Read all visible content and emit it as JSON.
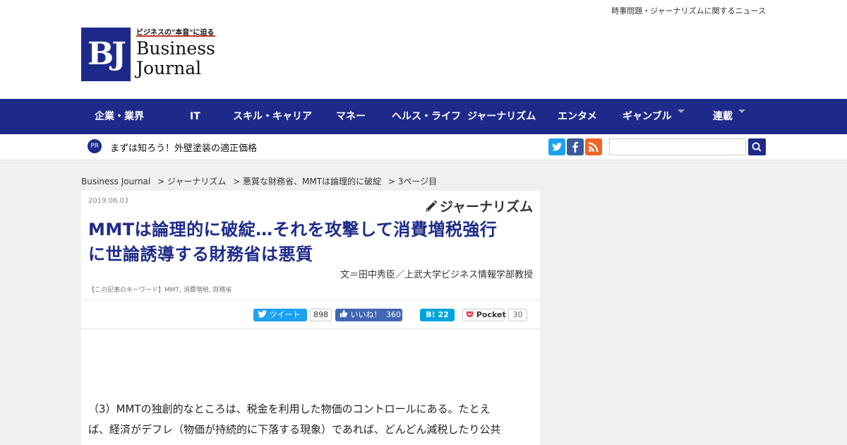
{
  "header": {
    "tagline": "時事問題・ジャーナリズムに関するニュース",
    "logo": {
      "mark": "BJ",
      "tag": "ビジネスの\"本音\"に迫る",
      "line1": "Business",
      "line2": "Journal"
    }
  },
  "nav": {
    "items": [
      {
        "label": "企業・業界",
        "dropdown": false
      },
      {
        "label": "IT",
        "dropdown": false
      },
      {
        "label": "スキル・キャリア",
        "dropdown": false
      },
      {
        "label": "マネー",
        "dropdown": false
      },
      {
        "label": "ヘルス・ライフ",
        "dropdown": false
      },
      {
        "label": "ジャーナリズム",
        "dropdown": false
      },
      {
        "label": "エンタメ",
        "dropdown": false
      },
      {
        "label": "ギャンブル",
        "dropdown": true
      },
      {
        "label": "連載",
        "dropdown": true
      }
    ]
  },
  "subbar": {
    "pr_badge": "PR",
    "pr_text": "まずは知ろう！外壁塗装の適正価格",
    "search_value": ""
  },
  "breadcrumb": {
    "items": [
      "Business Journal",
      "> ジャーナリズム",
      "> 悪質な財務省、MMTは論理的に破綻",
      "> 3ページ目"
    ]
  },
  "article": {
    "date": "2019.06.03",
    "category": "ジャーナリズム",
    "title_line1": "MMTは論理的に破綻…それを攻撃して消費増税強行",
    "title_line2": "に世論誘導する財務省は悪質",
    "author": "文＝田中秀臣／上武大学ビジネス情報学部教授",
    "keywords": "【この記事のキーワード】MMT, 消費増税, 財務省",
    "share": {
      "tweet_label": "ツイート",
      "tweet_count": "898",
      "like_label": "いいね！",
      "like_count": "360",
      "hatena_count": "22",
      "pocket_label": "Pocket",
      "pocket_count": "30"
    },
    "body_line1": "（3）MMTの独創的なところは、税金を利用した物価のコントロールにある。たとえ",
    "body_line2": "ば、経済がデフレ（物価が持続的に下落する現象）であれば、どんどん減税したり公共"
  },
  "colors": {
    "brand_navy": "#1e2a8a",
    "twitter": "#1da1f2",
    "facebook": "#3b5998",
    "hatena": "#00a4de",
    "pocket": "#ef4056"
  }
}
